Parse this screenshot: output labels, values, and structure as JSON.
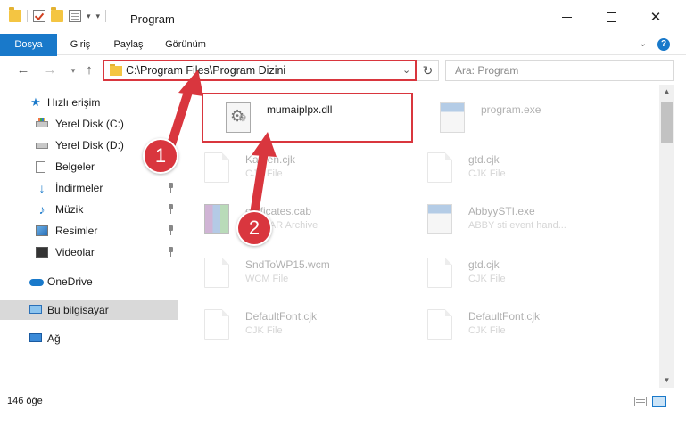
{
  "window": {
    "title": "Program"
  },
  "ribbon": {
    "tabs": [
      "Dosya",
      "Giriş",
      "Paylaş",
      "Görünüm"
    ]
  },
  "address_bar": {
    "path": "C:\\Program Files\\Program Dizini"
  },
  "search": {
    "placeholder": "Ara: Program"
  },
  "sidebar": {
    "quick_access": "Hızlı erişim",
    "items": [
      "Yerel Disk (C:)",
      "Yerel Disk (D:)",
      "Belgeler",
      "İndirmeler",
      "Müzik",
      "Resimler",
      "Videolar"
    ],
    "onedrive": "OneDrive",
    "this_pc": "Bu bilgisayar",
    "network": "Ağ"
  },
  "files": [
    {
      "name": "mumaiplpx.dll",
      "type": "",
      "icon": "dll-gear-icon"
    },
    {
      "name": "program.exe",
      "type": "",
      "icon": "exe-icon"
    },
    {
      "name": "Kamen.cjk",
      "type": "CJK File",
      "icon": "blank-file-icon"
    },
    {
      "name": "gtd.cjk",
      "type": "CJK File",
      "icon": "blank-file-icon"
    },
    {
      "name": "ertificates.cab",
      "type": "WinRAR Archive",
      "icon": "rar-icon"
    },
    {
      "name": "AbbyySTI.exe",
      "type": "ABBY sti event hand...",
      "icon": "exe-icon"
    },
    {
      "name": "SndToWP15.wcm",
      "type": "WCM File",
      "icon": "blank-file-icon"
    },
    {
      "name": "gtd.cjk",
      "type": "CJK File",
      "icon": "blank-file-icon"
    },
    {
      "name": "DefaultFont.cjk",
      "type": "CJK File",
      "icon": "blank-file-icon"
    },
    {
      "name": "DefaultFont.cjk",
      "type": "CJK File",
      "icon": "blank-file-icon"
    }
  ],
  "status": {
    "count": "146 öğe"
  },
  "annotations": {
    "step1": "1",
    "step2": "2",
    "color": "#d9363e"
  },
  "colors": {
    "accent": "#1979ca",
    "highlight": "#d9363e"
  }
}
